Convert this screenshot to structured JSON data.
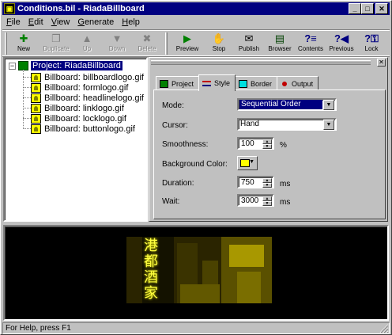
{
  "window": {
    "title": "Conditions.bil - RiadaBillboard",
    "app_icon_glyph": "▣",
    "controls": {
      "minimize": "_",
      "maximize": "□",
      "close": "✕"
    }
  },
  "menu": [
    {
      "label": "File",
      "icon": "none"
    },
    {
      "label": "Edit",
      "icon": "none"
    },
    {
      "label": "View",
      "icon": "none"
    },
    {
      "label": "Generate",
      "icon": "none"
    },
    {
      "label": "Help",
      "icon": "none"
    }
  ],
  "toolbar": {
    "new": {
      "label": "New",
      "glyph": "✚",
      "color": "#008000"
    },
    "duplicate": {
      "label": "Duplicate",
      "glyph": "❐",
      "color": "#808080"
    },
    "up": {
      "label": "Up",
      "glyph": "▲",
      "color": "#808080"
    },
    "down": {
      "label": "Down",
      "glyph": "▼",
      "color": "#808080"
    },
    "delete": {
      "label": "Delete",
      "glyph": "✖",
      "color": "#808080"
    },
    "preview": {
      "label": "Preview",
      "glyph": "▶",
      "color": "#008000"
    },
    "stop": {
      "label": "Stop",
      "glyph": "✋",
      "color": "#c00000"
    },
    "publish": {
      "label": "Publish",
      "glyph": "✉",
      "color": "#000000"
    },
    "browser": {
      "label": "Browser",
      "glyph": "▤",
      "color": "#004000"
    },
    "contents": {
      "label": "Contents",
      "glyph": "?≡",
      "color": "#000080"
    },
    "previous": {
      "label": "Previous",
      "glyph": "?◀",
      "color": "#000080"
    },
    "lock": {
      "label": "Lock",
      "glyph": "?⚿",
      "color": "#000080"
    }
  },
  "tree": {
    "root_label": "Project: RiadaBillboard",
    "expand_glyph": "−",
    "items": [
      "Billboard: billboardlogo.gif",
      "Billboard: formlogo.gif",
      "Billboard: headlinelogo.gif",
      "Billboard: linklogo.gif",
      "Billboard: locklogo.gif",
      "Billboard: buttonlogo.gif"
    ]
  },
  "panel": {
    "close_glyph": "✕",
    "tabs": [
      {
        "label": "Project",
        "color": "#008000",
        "active": false
      },
      {
        "label": "Style",
        "color": "#c00000",
        "active": true
      },
      {
        "label": "Border",
        "color": "#00c0c0",
        "active": false
      },
      {
        "label": "Output",
        "color": "#c00000",
        "active": false
      }
    ],
    "fields": {
      "mode_label": "Mode:",
      "mode_value": "Sequential Order",
      "cursor_label": "Cursor:",
      "cursor_value": "Hand",
      "smoothness_label": "Smoothness:",
      "smoothness_value": "100",
      "smoothness_unit": "%",
      "bgcolor_label": "Background Color:",
      "bgcolor_value": "#ffff00",
      "duration_label": "Duration:",
      "duration_value": "750",
      "duration_unit": "ms",
      "wait_label": "Wait:",
      "wait_value": "3000",
      "wait_unit": "ms"
    }
  },
  "preview": {
    "billboard_glyphs": "港都酒家",
    "billboard_tint": "#ffff00"
  },
  "status": {
    "text": "For Help, press F1"
  }
}
